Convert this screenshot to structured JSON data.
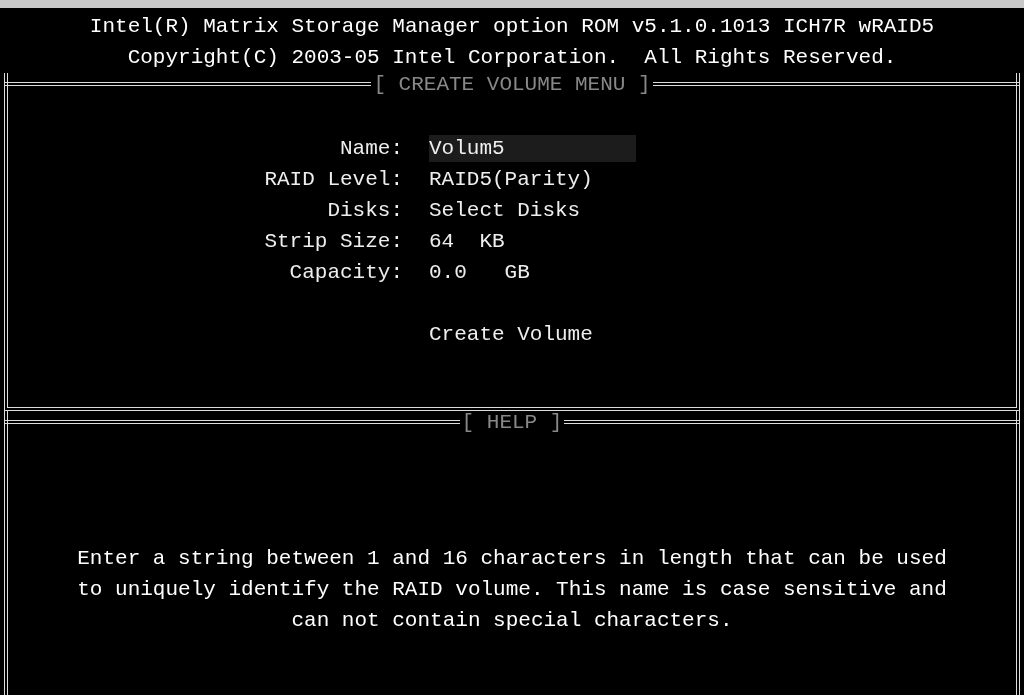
{
  "header": {
    "lines": [
      "Intel(R) Matrix Storage Manager option ROM v5.1.0.1013 ICH7R wRAID5",
      "Copyright(C) 2003-05 Intel Corporation.  All Rights Reserved."
    ]
  },
  "create_volume_menu": {
    "title": "[ CREATE VOLUME MENU ]",
    "fields": [
      {
        "label": "Name:",
        "value": "Volum5",
        "selected": true
      },
      {
        "label": "RAID Level:",
        "value": "RAID5(Parity)",
        "selected": false
      },
      {
        "label": "Disks:",
        "value": "Select Disks",
        "selected": false
      },
      {
        "label": "Strip Size:",
        "value": "64  KB",
        "selected": false
      },
      {
        "label": "Capacity:",
        "value": "0.0   GB",
        "selected": false
      }
    ],
    "action": {
      "label": "Create Volume",
      "selected": false
    }
  },
  "help": {
    "title": "[ HELP ]",
    "text": [
      "Enter a string between 1 and 16 characters in length that can be used",
      "to uniquely identify the RAID volume. This name is case sensitive and",
      "can not contain special characters."
    ]
  }
}
